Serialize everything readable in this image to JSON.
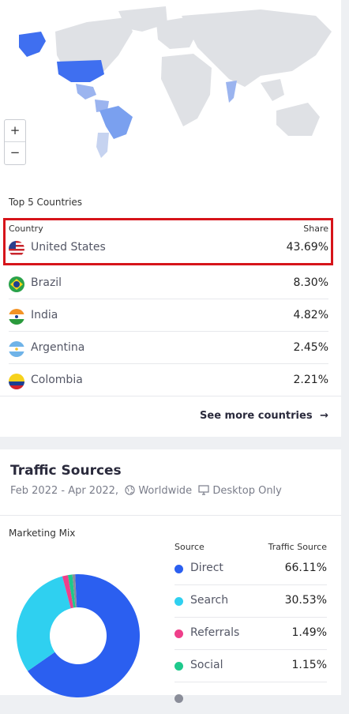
{
  "map": {
    "zoom_in": "+",
    "zoom_out": "−"
  },
  "top_countries": {
    "title": "Top 5 Countries",
    "col_country": "Country",
    "col_share": "Share",
    "rows": [
      {
        "name": "United States",
        "share": "43.69%",
        "flag": "us-flag"
      },
      {
        "name": "Brazil",
        "share": "8.30%",
        "flag": "brazil-flag"
      },
      {
        "name": "India",
        "share": "4.82%",
        "flag": "india-flag"
      },
      {
        "name": "Argentina",
        "share": "2.45%",
        "flag": "argentina-flag"
      },
      {
        "name": "Colombia",
        "share": "2.21%",
        "flag": "colombia-flag"
      }
    ],
    "see_more": "See more countries",
    "see_more_icon": "arrow-right-icon"
  },
  "traffic_sources": {
    "title": "Traffic Sources",
    "date_range": "Feb 2022 - Apr 2022,",
    "region": "Worldwide",
    "device": "Desktop Only",
    "marketing_mix": "Marketing Mix",
    "col_source": "Source",
    "col_traffic": "Traffic Source",
    "rows": [
      {
        "name": "Direct",
        "value": "66.11%",
        "color": "#2b5ff0"
      },
      {
        "name": "Search",
        "value": "30.53%",
        "color": "#2fd0f0"
      },
      {
        "name": "Referrals",
        "value": "1.49%",
        "color": "#ef3f8a"
      },
      {
        "name": "Social",
        "value": "1.15%",
        "color": "#1ec98c"
      }
    ],
    "donut_shares": [
      66.11,
      30.53,
      1.49,
      1.15,
      0.72
    ]
  },
  "colors": {
    "highlight": "#d6141a",
    "map_highlight": "#3f6ff0",
    "map_land": "#dfe1e5"
  }
}
